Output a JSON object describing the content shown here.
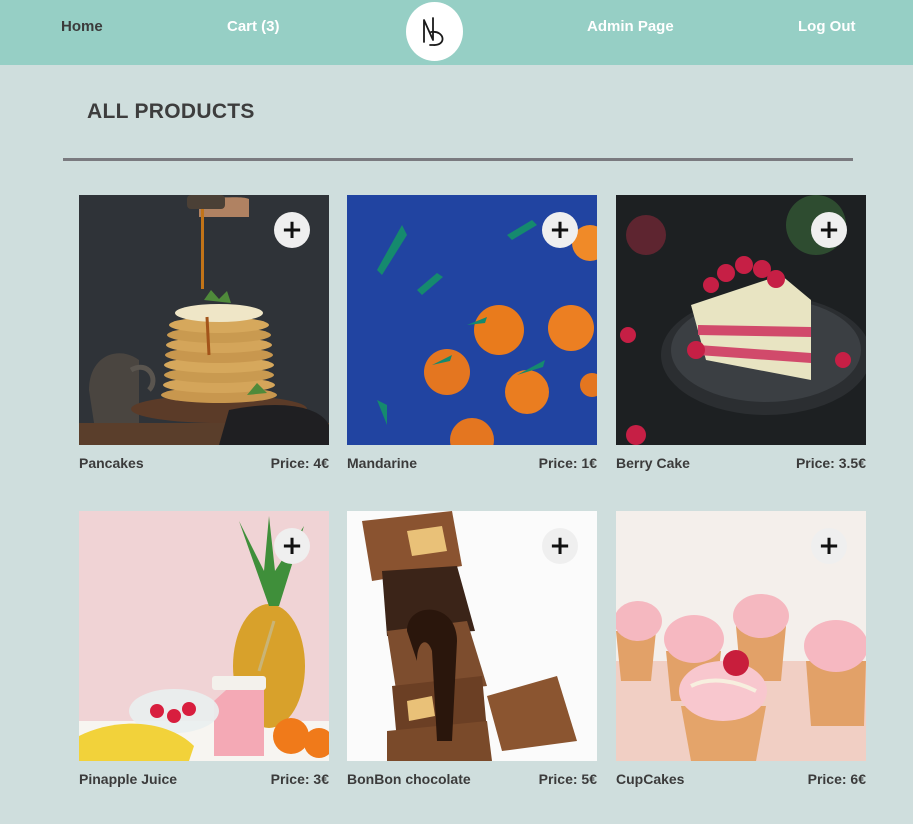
{
  "nav": {
    "home": "Home",
    "cart": "Cart (3)",
    "admin": "Admin Page",
    "logout": "Log Out"
  },
  "page": {
    "title": "ALL PRODUCTS"
  },
  "add_symbol": "+",
  "products": [
    {
      "name": "Pancakes",
      "price": "Price: 4€"
    },
    {
      "name": "Mandarine",
      "price": "Price: 1€"
    },
    {
      "name": "Berry Cake",
      "price": "Price: 3.5€"
    },
    {
      "name": "Pinapple Juice",
      "price": "Price: 3€"
    },
    {
      "name": "BonBon chocolate",
      "price": "Price: 5€"
    },
    {
      "name": "CupCakes",
      "price": "Price: 6€"
    }
  ],
  "colors": {
    "navbar": "#96cfc5",
    "background": "#cfdedd",
    "divider": "#7a7a7f",
    "text_dark": "#3b3b3b"
  }
}
